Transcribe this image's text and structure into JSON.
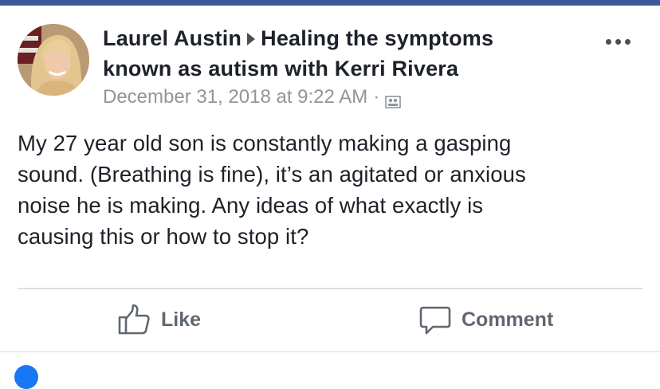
{
  "post": {
    "author": "Laurel Austin",
    "group_line1": "Healing the symptoms",
    "group_line2": "known as autism with Kerri Rivera",
    "timestamp": "December 31, 2018 at 9:22 AM",
    "separator": "·",
    "audience_icon": "group-icon",
    "body_lines": [
      "My 27 year old son is constantly making a gasping",
      "sound. (Breathing is fine), it’s an agitated or anxious",
      "noise he is making. Any ideas of what exactly is",
      "causing this or how to stop it?"
    ]
  },
  "actions": {
    "like_label": "Like",
    "comment_label": "Comment"
  },
  "colors": {
    "top_bar": "#3b5998",
    "text": "#1d2129",
    "meta": "#90949c",
    "action": "#606770",
    "divider": "#dddfe2"
  }
}
